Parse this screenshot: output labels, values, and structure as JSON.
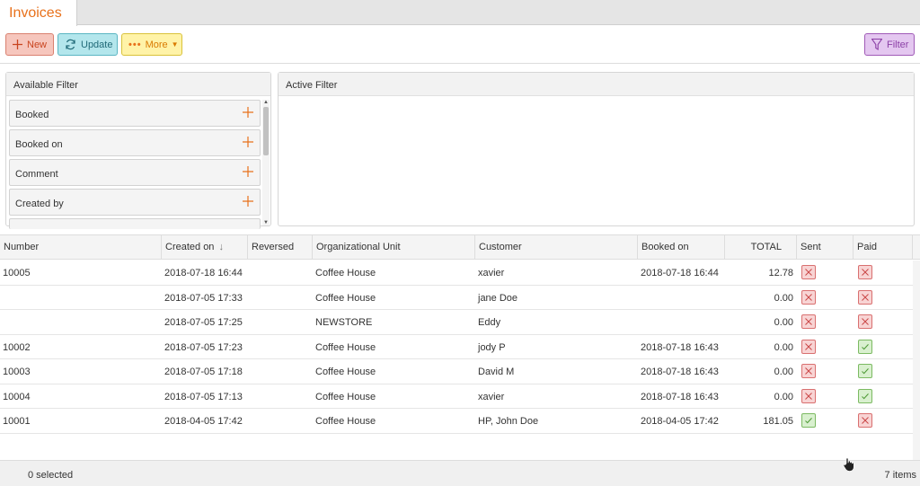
{
  "tab": {
    "title": "Invoices"
  },
  "toolbar": {
    "new_label": "New",
    "update_label": "Update",
    "more_label": "More",
    "filter_label": "Filter"
  },
  "available_filter": {
    "title": "Available Filter",
    "items": [
      "Booked",
      "Booked on",
      "Comment",
      "Created by"
    ]
  },
  "active_filter": {
    "title": "Active Filter"
  },
  "table": {
    "columns": [
      "Number",
      "Created on",
      "Reversed",
      "Organizational Unit",
      "Customer",
      "Booked on",
      "TOTAL",
      "Sent",
      "Paid"
    ],
    "rows": [
      {
        "number": "10005",
        "created_on": "2018-07-18 16:44",
        "reversed": "",
        "org_unit": "Coffee House",
        "customer": "xavier",
        "booked_on": "2018-07-18 16:44",
        "total": "12.78",
        "sent": false,
        "paid": false
      },
      {
        "number": "",
        "created_on": "2018-07-05 17:33",
        "reversed": "",
        "org_unit": "Coffee House",
        "customer": "jane Doe",
        "booked_on": "",
        "total": "0.00",
        "sent": false,
        "paid": false
      },
      {
        "number": "",
        "created_on": "2018-07-05 17:25",
        "reversed": "",
        "org_unit": "NEWSTORE",
        "customer": "Eddy",
        "booked_on": "",
        "total": "0.00",
        "sent": false,
        "paid": false
      },
      {
        "number": "10002",
        "created_on": "2018-07-05 17:23",
        "reversed": "",
        "org_unit": "Coffee House",
        "customer": "jody P",
        "booked_on": "2018-07-18 16:43",
        "total": "0.00",
        "sent": false,
        "paid": true
      },
      {
        "number": "10003",
        "created_on": "2018-07-05 17:18",
        "reversed": "",
        "org_unit": "Coffee House",
        "customer": "David M",
        "booked_on": "2018-07-18 16:43",
        "total": "0.00",
        "sent": false,
        "paid": true
      },
      {
        "number": "10004",
        "created_on": "2018-07-05 17:13",
        "reversed": "",
        "org_unit": "Coffee House",
        "customer": "xavier",
        "booked_on": "2018-07-18 16:43",
        "total": "0.00",
        "sent": false,
        "paid": true
      },
      {
        "number": "10001",
        "created_on": "2018-04-05 17:42",
        "reversed": "",
        "org_unit": "Coffee House",
        "customer": "HP, John Doe",
        "booked_on": "2018-04-05 17:42",
        "total": "181.05",
        "sent": true,
        "paid": false
      }
    ]
  },
  "footer": {
    "selected": "0 selected",
    "count": "7 items"
  },
  "colors": {
    "accent": "#e8711b",
    "no": "#d97070",
    "yes": "#7cba62"
  },
  "icons": {
    "new": "plus-icon",
    "update": "refresh-icon",
    "more": "dots-icon",
    "filter": "funnel-icon",
    "sort": "arrow-down-icon",
    "add": "plus-icon",
    "sent_paid_no": "x-box-icon",
    "sent_paid_yes": "check-box-icon"
  }
}
